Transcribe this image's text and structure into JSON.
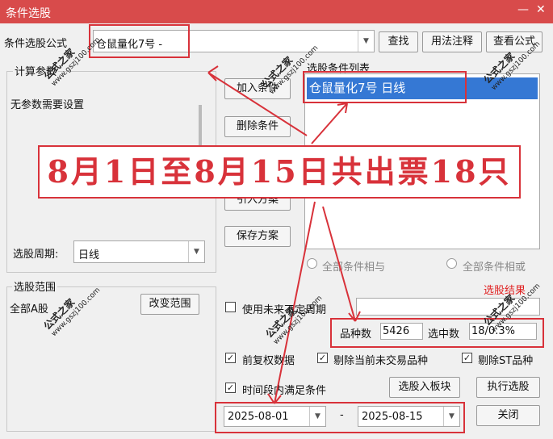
{
  "window": {
    "title": "条件选股",
    "minimize": "—",
    "close": "✕"
  },
  "formula": {
    "label": "条件选股公式",
    "value": "仓鼠量化7号  -",
    "find_btn": "查找",
    "usage_btn": "用法注释",
    "view_btn": "查看公式"
  },
  "calc_params": {
    "title": "计算参数",
    "text": "无参数需要设置"
  },
  "period": {
    "label": "选股周期:",
    "value": "日线"
  },
  "scope": {
    "title": "选股范围",
    "value": "全部A股",
    "change_btn": "改变范围"
  },
  "actions": {
    "add": "加入条件",
    "delete": "删除条件",
    "import": "引入方案",
    "save": "保存方案"
  },
  "conditions": {
    "title": "选股条件列表",
    "items": [
      "仓鼠量化7号  日线"
    ]
  },
  "logic": {
    "and": "全部条件相与",
    "or": "全部条件相或"
  },
  "result_label": "选股结果",
  "indefinite": "使用未来不定周期",
  "stats": {
    "count_label": "品种数",
    "count": "5426",
    "selected_label": "选中数",
    "selected": "18/0.3%"
  },
  "options": {
    "adjusted": "前复权数据",
    "exclude_untraded": "剔除当前未交易品种",
    "exclude_st": "剔除ST品种",
    "time_range": "时间段内满足条件"
  },
  "buttons": {
    "to_block": "选股入板块",
    "execute": "执行选股",
    "close": "关闭"
  },
  "dates": {
    "from": "2025-08-01",
    "sep": "-",
    "to": "2025-08-15"
  },
  "banner": "8月1日至8月15日共出票18只",
  "watermark": {
    "brand": "公式之家",
    "url": "www.gszj100.com"
  }
}
